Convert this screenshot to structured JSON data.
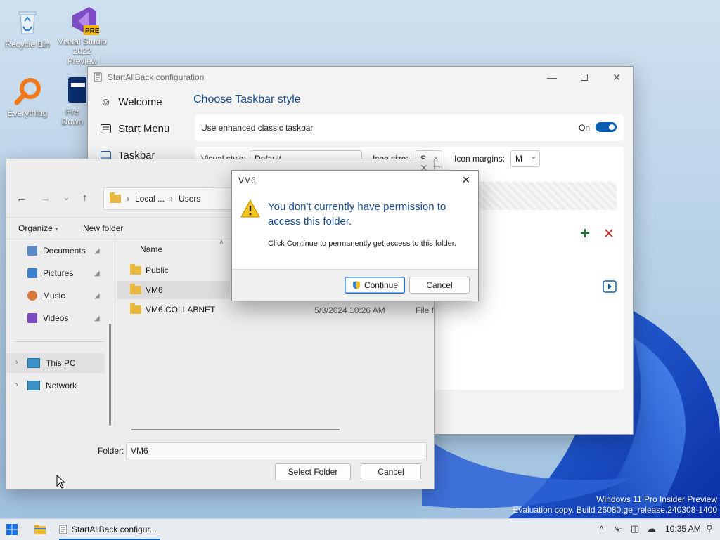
{
  "desktop": {
    "icons": [
      {
        "label": "Recycle Bin"
      },
      {
        "label": "Visual Studio 2022 Preview",
        "badge": "PRE"
      },
      {
        "label": "Everything"
      },
      {
        "label": "Fre Down"
      }
    ],
    "watermark": {
      "line1": "Windows 11 Pro Insider Preview",
      "line2": "Evaluation copy. Build 26080.ge_release.240308-1400"
    }
  },
  "startallback": {
    "title": "StartAllBack configuration",
    "nav": [
      {
        "label": "Welcome",
        "icon": "smiley-icon"
      },
      {
        "label": "Start Menu",
        "icon": "start-menu-icon"
      },
      {
        "label": "Taskbar",
        "icon": "taskbar-icon"
      }
    ],
    "heading": "Choose Taskbar style",
    "enhanced_label": "Use enhanced classic taskbar",
    "toggle_state": "On",
    "visual_style_label": "Visual style:",
    "visual_style_value": "Default",
    "icon_size_label": "Icon size:",
    "icon_size_value": "S",
    "icon_margins_label": "Icon margins:",
    "icon_margins_value": "M",
    "accent_add": "#1a7f2a",
    "accent_remove": "#c0392b"
  },
  "explorer": {
    "path": {
      "segment1": "Local ...",
      "segment2": "Users"
    },
    "organize_label": "Organize",
    "new_folder_label": "New folder",
    "nav": [
      {
        "label": "Documents",
        "icon": "documents-icon",
        "pinned": true
      },
      {
        "label": "Pictures",
        "icon": "pictures-icon",
        "pinned": true
      },
      {
        "label": "Music",
        "icon": "music-icon",
        "pinned": true
      },
      {
        "label": "Videos",
        "icon": "videos-icon",
        "pinned": true
      },
      {
        "label": "This PC",
        "icon": "this-pc-icon"
      },
      {
        "label": "Network",
        "icon": "network-icon"
      }
    ],
    "column_name": "Name",
    "files": [
      {
        "name": "Public",
        "date": "",
        "type": ""
      },
      {
        "name": "VM6",
        "date": "",
        "type": ""
      },
      {
        "name": "VM6.COLLABNET",
        "date": "5/3/2024 10:26 AM",
        "type": "File f"
      }
    ],
    "folder_label": "Folder:",
    "folder_value": "VM6",
    "select_button": "Select Folder",
    "cancel_button": "Cancel"
  },
  "dialog": {
    "title": "VM6",
    "main": "You don't currently have permission to access this folder.",
    "detail": "Click Continue to permanently get access to this folder.",
    "continue": "Continue",
    "cancel": "Cancel"
  },
  "taskbar": {
    "app_label": "StartAllBack configur...",
    "time": "10:35 AM"
  }
}
